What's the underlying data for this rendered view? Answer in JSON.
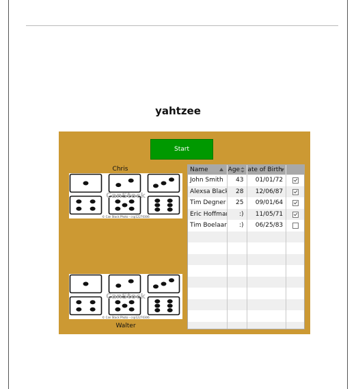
{
  "page": {
    "title": "yahtzee"
  },
  "game": {
    "start_label": "Start",
    "player_top": "Chris",
    "player_bottom": "Walter",
    "dice_watermark": "CanStock",
    "dice_credit": "© Can Stock Photo - csp12270306"
  },
  "table": {
    "columns": [
      "Name",
      "Age",
      "Date of Birth",
      ""
    ],
    "rows": [
      {
        "name": "John Smith",
        "age": "43",
        "dob": "01/01/72",
        "checked": true
      },
      {
        "name": "Alexsa Black",
        "age": "28",
        "dob": "12/06/87",
        "checked": true
      },
      {
        "name": "Tim Degner",
        "age": "25",
        "dob": "09/01/64",
        "checked": true
      },
      {
        "name": "Eric Hoffman",
        "age": ":)",
        "dob": "11/05/71",
        "checked": true
      },
      {
        "name": "Tim Boelaars",
        "age": ":)",
        "dob": "06/25/83",
        "checked": false
      }
    ],
    "empty_rows": 9
  }
}
